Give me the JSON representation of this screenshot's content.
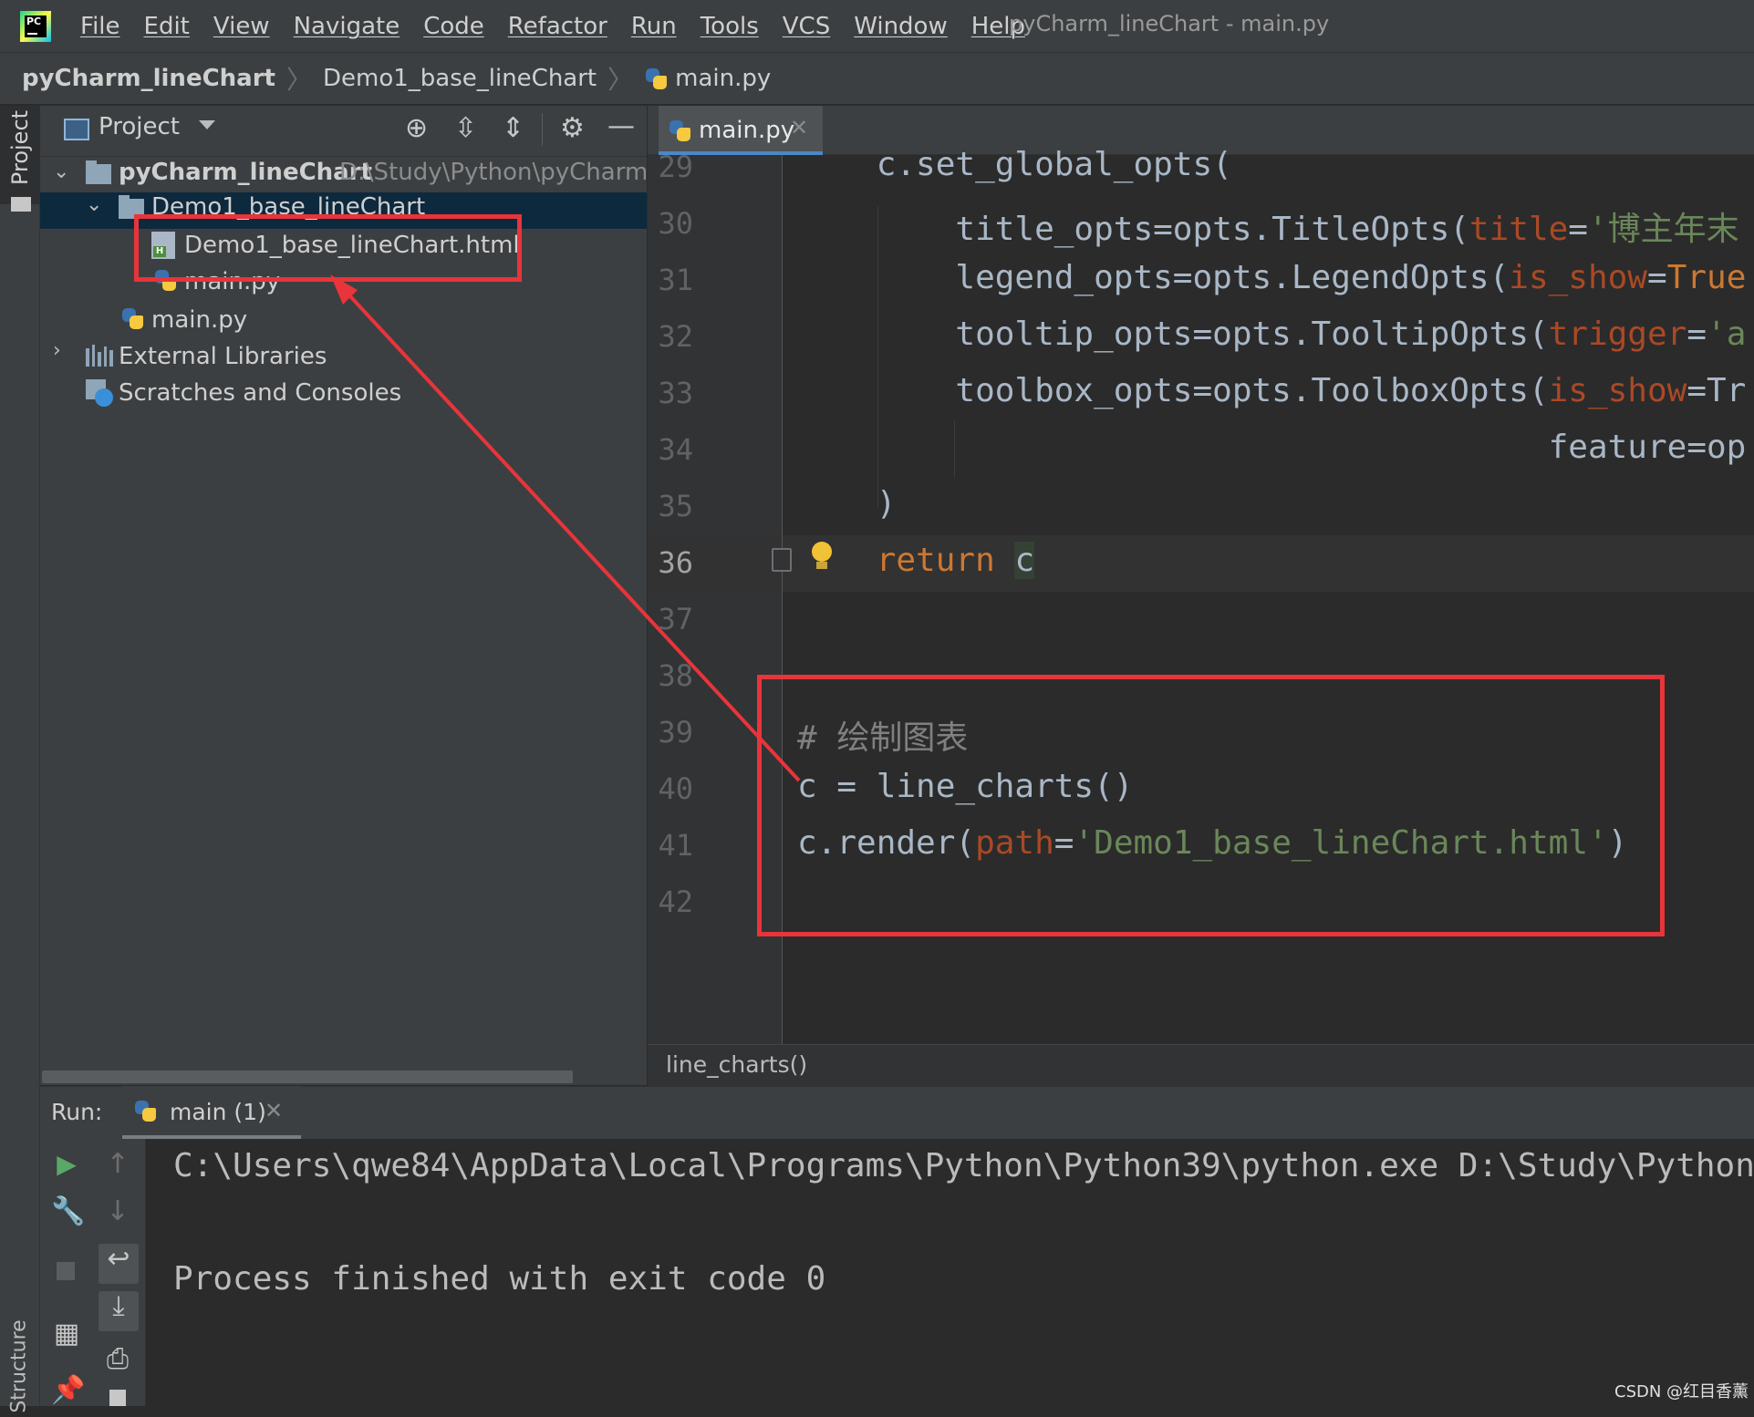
{
  "menu": {
    "items": [
      "File",
      "Edit",
      "View",
      "Navigate",
      "Code",
      "Refactor",
      "Run",
      "Tools",
      "VCS",
      "Window",
      "Help"
    ],
    "window_title": "pyCharm_lineChart - main.py",
    "logo_text": "PC"
  },
  "breadcrumb": {
    "project": "pyCharm_lineChart",
    "folder": "Demo1_base_lineChart",
    "file": "main.py"
  },
  "left_strip": {
    "project_label": "Project",
    "structure_label": "Structure"
  },
  "project_panel": {
    "header_title": "Project",
    "tree": {
      "root_name": "pyCharm_lineChart",
      "root_path": "D:\\Study\\Python\\pyCharm_lineChart",
      "folder_name": "Demo1_base_lineChart",
      "file_html": "Demo1_base_lineChart.html",
      "file_inner_py": "main.py",
      "file_root_py": "main.py",
      "external_libraries": "External Libraries",
      "scratches": "Scratches and Consoles"
    }
  },
  "editor": {
    "tab_label": "main.py",
    "current_line": 36,
    "lines": [
      {
        "n": "29",
        "code": "    c.set_global_opts("
      },
      {
        "n": "30",
        "code": "        title_opts=opts.TitleOpts(title='博主年末"
      },
      {
        "n": "31",
        "code": "        legend_opts=opts.LegendOpts(is_show=True"
      },
      {
        "n": "32",
        "code": "        tooltip_opts=opts.TooltipOpts(trigger='a"
      },
      {
        "n": "33",
        "code": "        toolbox_opts=opts.ToolboxOpts(is_show=Tr"
      },
      {
        "n": "34",
        "code": "                                      feature=op"
      },
      {
        "n": "35",
        "code": "    )"
      },
      {
        "n": "36",
        "code": "    return c"
      },
      {
        "n": "37",
        "code": ""
      },
      {
        "n": "38",
        "code": ""
      },
      {
        "n": "39",
        "code": "# 绘制图表"
      },
      {
        "n": "40",
        "code": "c = line_charts()"
      },
      {
        "n": "41",
        "code": "c.render(path='Demo1_base_lineChart.html')"
      },
      {
        "n": "42",
        "code": ""
      }
    ],
    "breadcrumb_fn": "line_charts()"
  },
  "run_panel": {
    "label": "Run:",
    "tab_label": "main (1)",
    "output": [
      "C:\\Users\\qwe84\\AppData\\Local\\Programs\\Python\\Python39\\python.exe D:\\Study\\Python",
      "",
      "Process finished with exit code 0"
    ]
  },
  "icons": {
    "header": [
      "locate-icon",
      "expand-all-icon",
      "collapse-all-icon",
      "settings-icon",
      "hide-icon"
    ],
    "run_toolbar": [
      "run-icon",
      "up-arrow-icon",
      "wrench-icon",
      "down-arrow-icon",
      "stop-icon",
      "soft-wrap-icon",
      "scroll-to-end-icon",
      "layout-icon",
      "print-icon",
      "pin-icon",
      "trash-icon"
    ]
  },
  "colors": {
    "annotation_red": "#e8343a",
    "keyword": "#cc7832",
    "parameter": "#aa4926",
    "string": "#6a8759",
    "comment": "#808080",
    "selection": "#0d293e"
  },
  "watermark": "CSDN @红目香薰"
}
